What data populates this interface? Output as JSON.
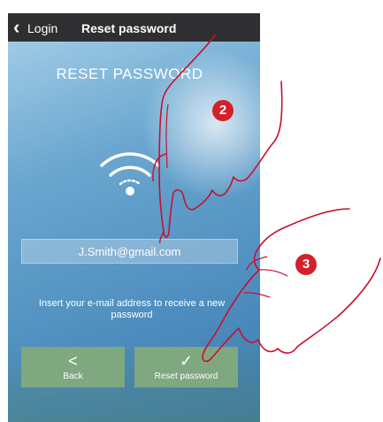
{
  "navbar": {
    "back_label": "Login",
    "title": "Reset password"
  },
  "screen": {
    "heading": "RESET PASSWORD",
    "email_value": "J.Smith@gmail.com",
    "hint": "Insert your e-mail address to receive a new password"
  },
  "buttons": {
    "back_icon": "<",
    "back_label": "Back",
    "reset_icon": "✓",
    "reset_label": "Reset password"
  },
  "callouts": {
    "step_2": "2",
    "step_3": "3"
  },
  "icons": [
    "wifi-icon",
    "chevron-left-icon",
    "checkmark-icon",
    "pointing-hand-icon"
  ],
  "colors": {
    "navbar": "#2f2f31",
    "button": "#7fa780",
    "badge": "#d4202a",
    "hand_outline": "#c8102e"
  }
}
